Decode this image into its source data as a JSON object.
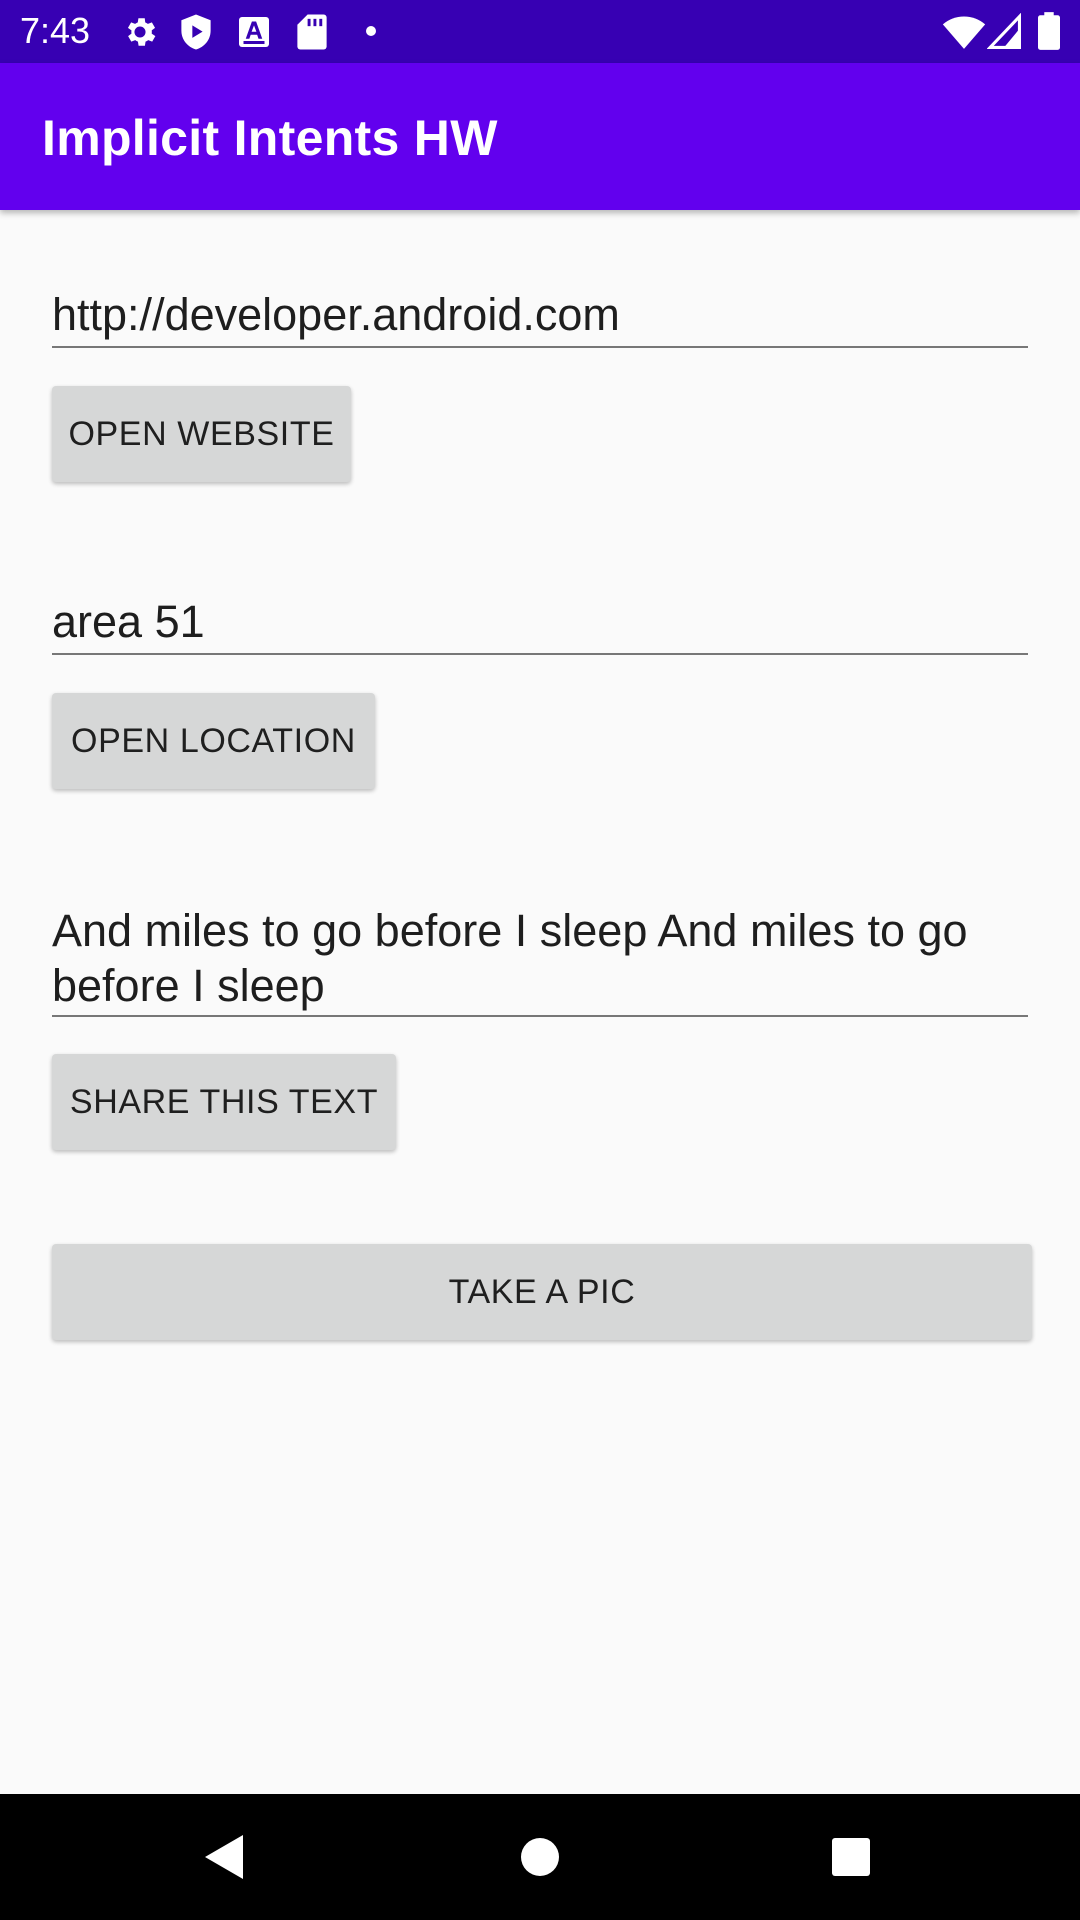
{
  "status_bar": {
    "time": "7:43",
    "left_icons": [
      "settings-gear-icon",
      "shield-play-icon",
      "font-a-icon",
      "sd-card-icon",
      "dot-icon"
    ],
    "right_icons": [
      "wifi-icon",
      "cell-signal-icon",
      "battery-icon"
    ]
  },
  "app_bar": {
    "title": "Implicit Intents HW",
    "color": "#6200ee",
    "status_color": "#3700b3"
  },
  "main": {
    "website_field": {
      "value": "http://developer.android.com"
    },
    "open_website_button": {
      "label": "OPEN WEBSITE"
    },
    "location_field": {
      "value": "area 51"
    },
    "open_location_button": {
      "label": "OPEN LOCATION"
    },
    "share_field": {
      "value": "And miles to go before I sleep And miles to go before I sleep"
    },
    "share_button": {
      "label": "SHARE THIS TEXT"
    },
    "take_pic_button": {
      "label": "TAKE A PIC"
    }
  },
  "nav_bar": {
    "buttons": [
      "back-icon",
      "home-icon",
      "recents-icon"
    ]
  }
}
